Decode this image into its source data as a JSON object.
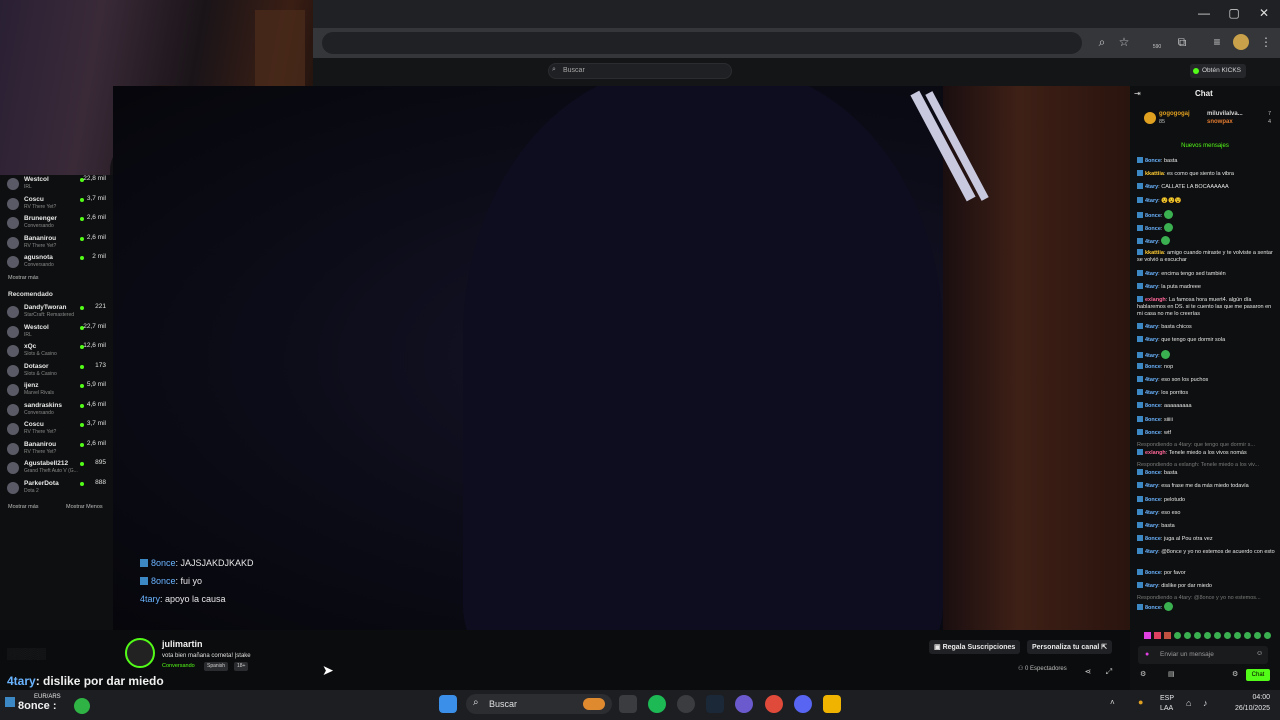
{
  "browser": {
    "window_controls": [
      "—",
      "▢",
      "✕"
    ],
    "toolbar_count": "590"
  },
  "kick": {
    "search_placeholder": "Buscar",
    "get_kicks_label": "Obtén KICKS"
  },
  "sidebar": {
    "following": [
      {
        "name": "Westcol",
        "sub": "IRL",
        "count": "22,8 mil"
      },
      {
        "name": "Coscu",
        "sub": "RV There Yet?",
        "count": "3,7 mil"
      },
      {
        "name": "Brunenger",
        "sub": "Conversando",
        "count": "2,6 mil"
      },
      {
        "name": "Bananirou",
        "sub": "RV There Yet?",
        "count": "2,6 mil"
      },
      {
        "name": "agusnota",
        "sub": "Conversando",
        "count": "2 mil"
      }
    ],
    "show_more": "Mostrar más",
    "recommended_title": "Recomendado",
    "recommended": [
      {
        "name": "DandyTworan",
        "sub": "StarCraft: Remastered",
        "count": "221"
      },
      {
        "name": "Westcol",
        "sub": "IRL",
        "count": "22,7 mil"
      },
      {
        "name": "xQc",
        "sub": "Slots & Casino",
        "count": "12,6 mil"
      },
      {
        "name": "Dotasor",
        "sub": "Slots & Casino",
        "count": "173"
      },
      {
        "name": "ijenz",
        "sub": "Marvel Rivals",
        "count": "5,9 mil"
      },
      {
        "name": "sandraskins",
        "sub": "Conversando",
        "count": "4,6 mil"
      },
      {
        "name": "Coscu",
        "sub": "RV There Yet?",
        "count": "3,7 mil"
      },
      {
        "name": "Bananirou",
        "sub": "RV There Yet?",
        "count": "2,6 mil"
      },
      {
        "name": "Agustabell212",
        "sub": "Grand Theft Auto V (G...",
        "count": "895"
      },
      {
        "name": "ParkerDota",
        "sub": "Dota 2",
        "count": "888"
      }
    ],
    "show_more_2": "Mostrar más",
    "show_less": "Mostrar Menos"
  },
  "video_overlay": [
    {
      "user": "8once",
      "text": ": JAJSJAKDJKAKD"
    },
    {
      "user": "8once",
      "text": ": fui yo"
    },
    {
      "user": "4tary",
      "text": ": apoyo la causa"
    }
  ],
  "stream": {
    "streamer": "julimartin",
    "title": "vota bien mañana corneta! |stake",
    "category": "Conversando",
    "tags": [
      "Spanish",
      "18+"
    ],
    "gift_subs": "Regala Suscripciones",
    "customize": "Personaliza tu canal",
    "viewers": "0 Espectadores"
  },
  "chat": {
    "title": "Chat",
    "pinned": [
      {
        "user": "gogogogaj",
        "count": "85"
      },
      {
        "user": "miluvilalva...",
        "count": "7"
      },
      {
        "user": "snowpax",
        "count": "4"
      }
    ],
    "new_messages": "Nuevos mensajes",
    "messages": [
      {
        "user": "8once",
        "text": "basta",
        "color": "#6ab4ff"
      },
      {
        "user": "kkattiia",
        "text": "es como que siento la vibra",
        "color": "#ffcc33"
      },
      {
        "user": "4tary",
        "text": "CALLATE LA BOCAAAAAA",
        "color": "#6ab4ff"
      },
      {
        "user": "4tary",
        "text": "😵😵😵",
        "color": "#6ab4ff"
      },
      {
        "user": "8once",
        "text": "",
        "color": "#6ab4ff"
      },
      {
        "user": "8once",
        "text": "",
        "color": "#6ab4ff"
      },
      {
        "user": "4tary",
        "text": "",
        "color": "#6ab4ff"
      },
      {
        "user": "kkattiia",
        "text": "amigo cuando miraste y te volviste a sentar se volvió a escuchar",
        "color": "#ffcc33"
      },
      {
        "user": "4tary",
        "text": "encima tengo sed también",
        "color": "#6ab4ff"
      },
      {
        "user": "4tary",
        "text": "la puta madreee",
        "color": "#6ab4ff"
      },
      {
        "user": "exlangh",
        "text": "La famosa hora muert4. algún día hablaremos en DS. si te cuento las que me pasaron en mi casa no me lo creerías",
        "color": "#ff6699"
      },
      {
        "user": "4tary",
        "text": "basta chicos",
        "color": "#6ab4ff"
      },
      {
        "user": "4tary",
        "text": "que tengo que dormir sola",
        "color": "#6ab4ff"
      },
      {
        "user": "4tary",
        "text": "",
        "color": "#6ab4ff"
      },
      {
        "user": "8once",
        "text": "nop",
        "color": "#6ab4ff"
      },
      {
        "user": "4tary",
        "text": "eso son los puchos",
        "color": "#6ab4ff"
      },
      {
        "user": "4tary",
        "text": "los porritos",
        "color": "#6ab4ff"
      },
      {
        "user": "8once",
        "text": "aaaaaaaaa",
        "color": "#6ab4ff"
      },
      {
        "user": "8once",
        "text": "siiiii",
        "color": "#6ab4ff"
      },
      {
        "user": "8once",
        "text": "wtf",
        "color": "#6ab4ff"
      },
      {
        "user": "exlangh",
        "text": "Tenele miedo a los vivos nomás",
        "color": "#ff6699",
        "reply": "Respondiendo a 4tary: que tengo que dormir s..."
      },
      {
        "user": "8once",
        "text": "basta",
        "color": "#6ab4ff",
        "reply": "Respondiendo a exlangh: Tenele miedo a los viv..."
      },
      {
        "user": "4tary",
        "text": "esa frase me da más miedo todavía",
        "color": "#6ab4ff"
      },
      {
        "user": "8once",
        "text": "pelotudo",
        "color": "#6ab4ff"
      },
      {
        "user": "4tary",
        "text": "eso eso",
        "color": "#6ab4ff"
      },
      {
        "user": "4tary",
        "text": "basta",
        "color": "#6ab4ff"
      },
      {
        "user": "8once",
        "text": "juga al Pou otra vez",
        "color": "#6ab4ff"
      },
      {
        "user": "4tary",
        "text": "@8once y yo no estemos de acuerdo con esto",
        "color": "#6ab4ff"
      },
      {
        "user": "8once",
        "text": "por favor",
        "color": "#6ab4ff"
      },
      {
        "user": "4tary",
        "text": "dislike por dar miedo",
        "color": "#6ab4ff"
      },
      {
        "user": "8once",
        "text": "",
        "color": "#6ab4ff",
        "reply": "Respondiendo a 4tary: @8once y yo no estemos..."
      }
    ],
    "input_placeholder": "Enviar un mensaje",
    "send_label": "Chat"
  },
  "obs_overlay": {
    "user": "4tary",
    "text": ": dislike por dar miedo",
    "fx_label": "EUR/ARS",
    "fx_name": "8once :"
  },
  "taskbar": {
    "search": "Buscar",
    "lang1": "ESP",
    "lang2": "LAA",
    "time": "04:00",
    "date": "26/10/2025"
  }
}
